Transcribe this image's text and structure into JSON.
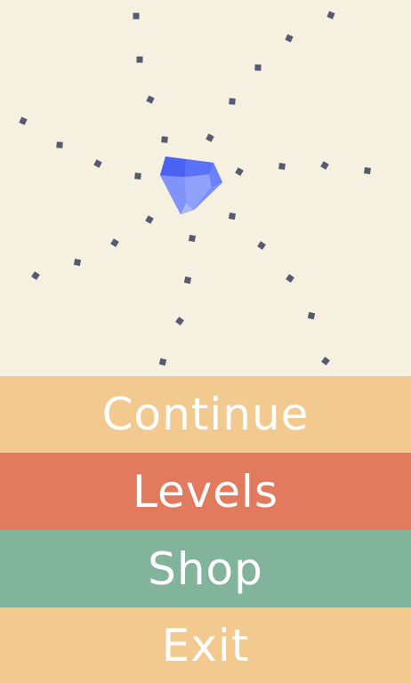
{
  "scene": {
    "background_color": "#f5f0df",
    "particle_color": "#555a70",
    "gem_colors": [
      "#3e55e8",
      "#5068f5",
      "#6d82f8",
      "#8b9df9",
      "#a9b6fb"
    ]
  },
  "menu": {
    "items": [
      {
        "label": "Continue",
        "color": "#f2c98f"
      },
      {
        "label": "Levels",
        "color": "#e27a5e"
      },
      {
        "label": "Shop",
        "color": "#82b39b"
      },
      {
        "label": "Exit",
        "color": "#f2c98f"
      }
    ]
  }
}
